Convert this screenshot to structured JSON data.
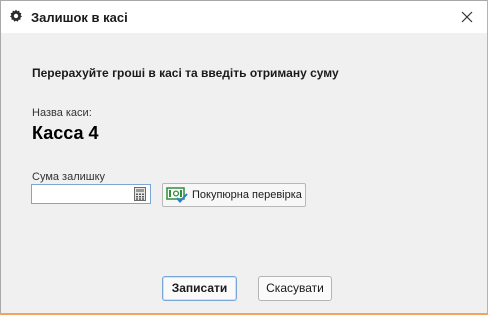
{
  "dialog": {
    "title": "Залишок в касі",
    "instruction": "Перерахуйте гроші в касі та введіть отриману суму",
    "kassa_label": "Назва каси:",
    "kassa_name": "Касса 4",
    "sum_label": "Сума залишку",
    "sum_value": "",
    "check_button_label": "Покупюрна перевірка",
    "save_button_label": "Записати",
    "cancel_button_label": "Скасувати"
  },
  "icons": {
    "title": "gear-icon",
    "close": "close-icon",
    "calculator": "calculator-icon",
    "banknote_check": "banknote-check-icon"
  },
  "colors": {
    "window_bg": "#f0f0f0",
    "titlebar_bg": "#ffffff",
    "focus_border": "#7aa7d6",
    "banknote_green": "#2f8f3a",
    "check_blue": "#2a7fd0",
    "window_edge": "#f3a45a"
  }
}
